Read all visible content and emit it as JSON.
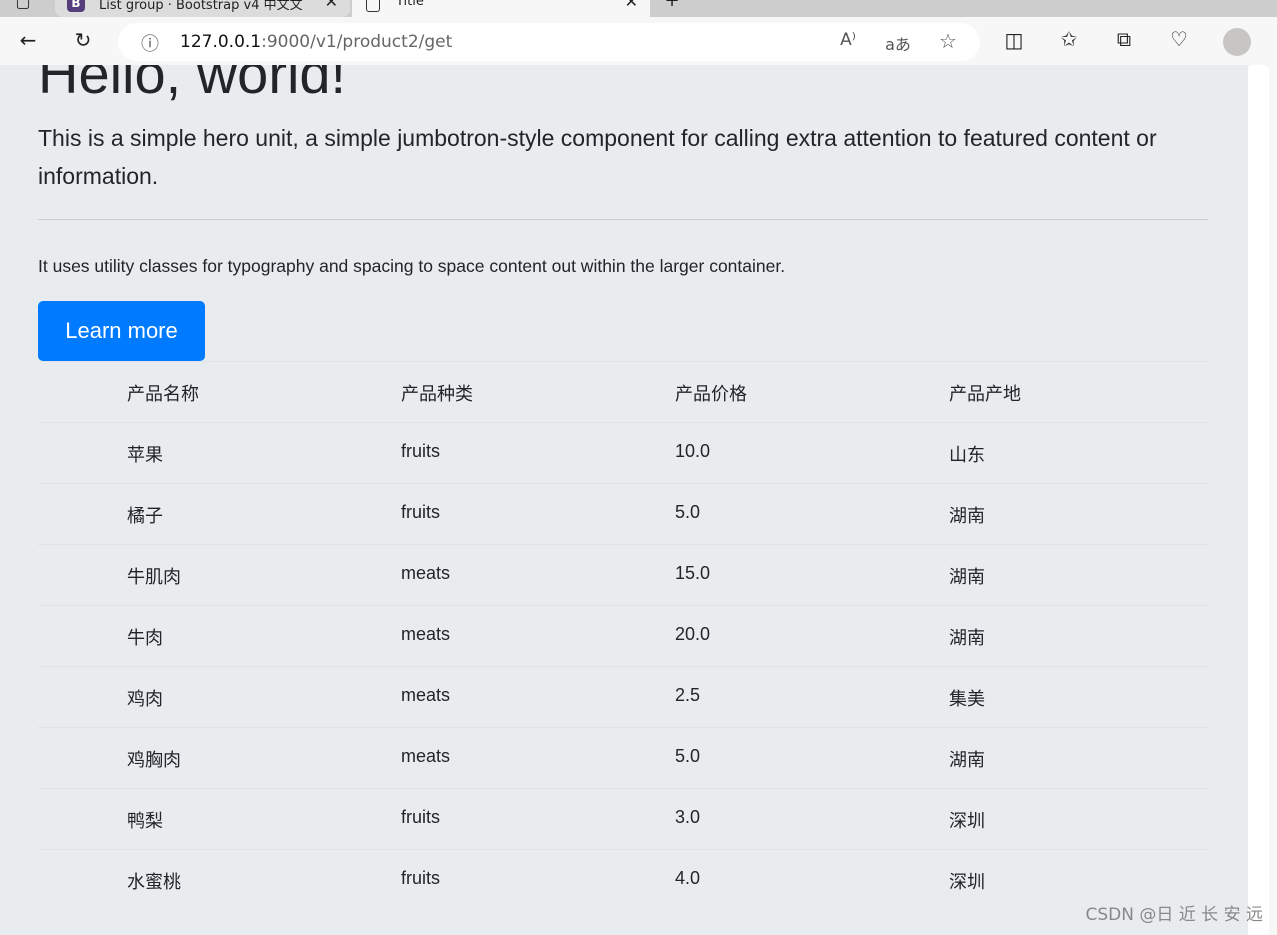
{
  "browser": {
    "tabs": [
      {
        "title": "List group · Bootstrap v4 中文文",
        "favicon": "B"
      },
      {
        "title": "Title"
      }
    ],
    "url_host": "127.0.0.1",
    "url_rest": ":9000/v1/product2/get"
  },
  "hero": {
    "title": "Hello, world!",
    "lead": "This is a simple hero unit, a simple jumbotron-style component for calling extra attention to featured content or information.",
    "text": "It uses utility classes for typography and spacing to space content out within the larger container.",
    "button": "Learn more",
    "button_color": "#007bff"
  },
  "table": {
    "headers": [
      "产品名称",
      "产品种类",
      "产品价格",
      "产品产地"
    ],
    "rows": [
      [
        "苹果",
        "fruits",
        "10.0",
        "山东"
      ],
      [
        "橘子",
        "fruits",
        "5.0",
        "湖南"
      ],
      [
        "牛肌肉",
        "meats",
        "15.0",
        "湖南"
      ],
      [
        "牛肉",
        "meats",
        "20.0",
        "湖南"
      ],
      [
        "鸡肉",
        "meats",
        "2.5",
        "集美"
      ],
      [
        "鸡胸肉",
        "meats",
        "5.0",
        "湖南"
      ],
      [
        "鸭梨",
        "fruits",
        "3.0",
        "深圳"
      ],
      [
        "水蜜桃",
        "fruits",
        "4.0",
        "深圳"
      ]
    ]
  },
  "watermark": "CSDN @日 近 长 安 远"
}
